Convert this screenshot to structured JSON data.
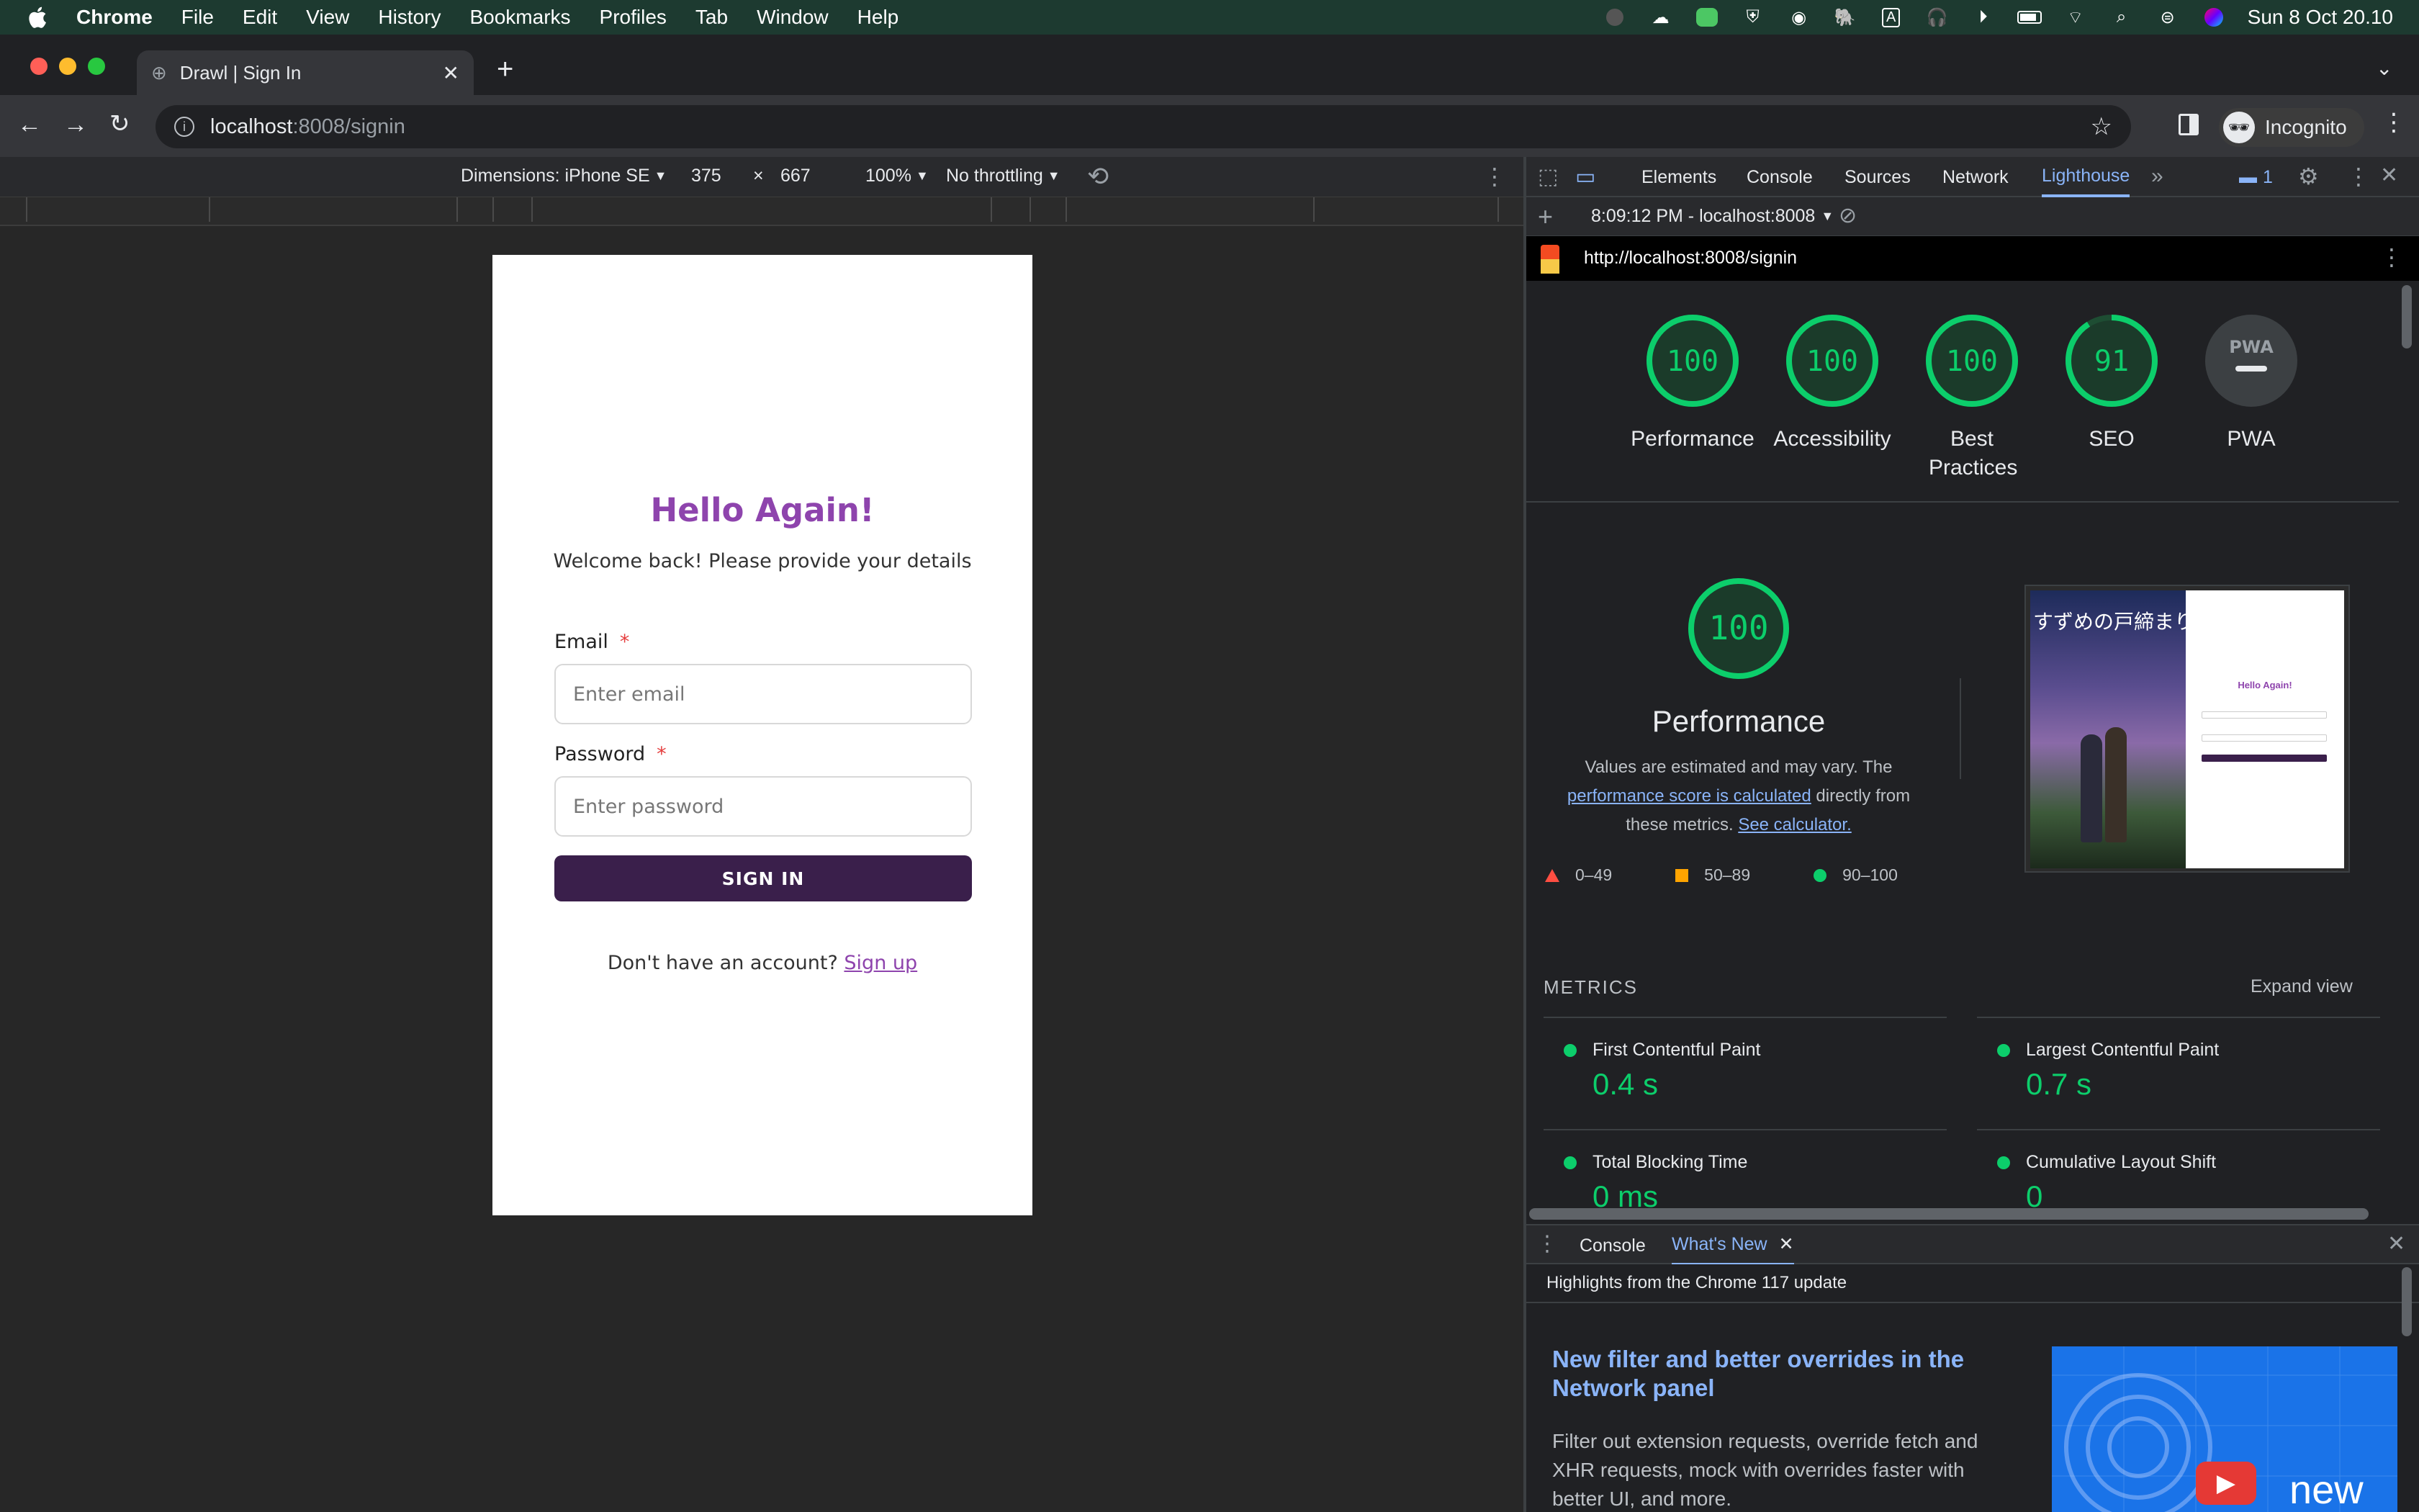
{
  "menubar": {
    "items": [
      "Chrome",
      "File",
      "Edit",
      "View",
      "History",
      "Bookmarks",
      "Profiles",
      "Tab",
      "Window",
      "Help"
    ],
    "clock": "Sun 8 Oct  20.10"
  },
  "browser": {
    "tab_title": "Drawl | Sign In",
    "url_host": "localhost",
    "url_rest": ":8008/signin",
    "profile_label": "Incognito"
  },
  "device_toolbar": {
    "dimensions": "Dimensions: iPhone SE",
    "width": "375",
    "times": "×",
    "height": "667",
    "zoom": "100%",
    "throttling": "No throttling"
  },
  "signin_page": {
    "heading": "Hello Again!",
    "subtitle": "Welcome back! Please provide your details",
    "email_label": "Email",
    "email_placeholder": "Enter email",
    "password_label": "Password",
    "password_placeholder": "Enter password",
    "required_mark": "*",
    "signin_button": "SIGN IN",
    "no_account_text": "Don't have an account?",
    "signup_link": "Sign up"
  },
  "devtools": {
    "tabs": [
      "Elements",
      "Console",
      "Sources",
      "Network",
      "Lighthouse"
    ],
    "active_tab": "Lighthouse",
    "issues_count": "1",
    "report_selector": "8:09:12 PM - localhost:8008",
    "report_url": "http://localhost:8008/signin"
  },
  "lighthouse": {
    "scores": [
      {
        "label": "Performance",
        "value": 100
      },
      {
        "label": "Accessibility",
        "value": 100
      },
      {
        "label": "Best Practices",
        "value": 100
      },
      {
        "label": "SEO",
        "value": 91
      },
      {
        "label": "PWA",
        "value": null
      }
    ],
    "pwa_badge": "PWA",
    "main_score": "100",
    "main_title": "Performance",
    "desc_1": "Values are estimated and may vary. The",
    "desc_link": "performance score is calculated",
    "desc_2": "directly from",
    "desc_3": "these metrics.",
    "calc_link": "See calculator.",
    "legend": [
      "0–49",
      "50–89",
      "90–100"
    ],
    "metrics_title": "METRICS",
    "expand_view": "Expand view",
    "metrics": [
      {
        "name": "First Contentful Paint",
        "value": "0.4 s"
      },
      {
        "name": "Largest Contentful Paint",
        "value": "0.7 s"
      },
      {
        "name": "Total Blocking Time",
        "value": "0 ms"
      },
      {
        "name": "Cumulative Layout Shift",
        "value": "0"
      }
    ],
    "thumb_heading": "Hello Again!",
    "thumb_jp": "すずめの戸締まり"
  },
  "drawer": {
    "tabs": [
      "Console",
      "What's New"
    ],
    "active": "What's New",
    "highlight": "Highlights from the Chrome 117 update",
    "article_title": "New filter and better overrides in the Network panel",
    "article_desc": "Filter out extension requests, override fetch and XHR requests, mock with overrides faster with better UI, and more.",
    "image_word": "new"
  },
  "colors": {
    "pass": "#0cce6b",
    "brand_purple": "#8e44ad",
    "button_dark": "#3a1f4b",
    "link_blue": "#8ab4f8"
  }
}
